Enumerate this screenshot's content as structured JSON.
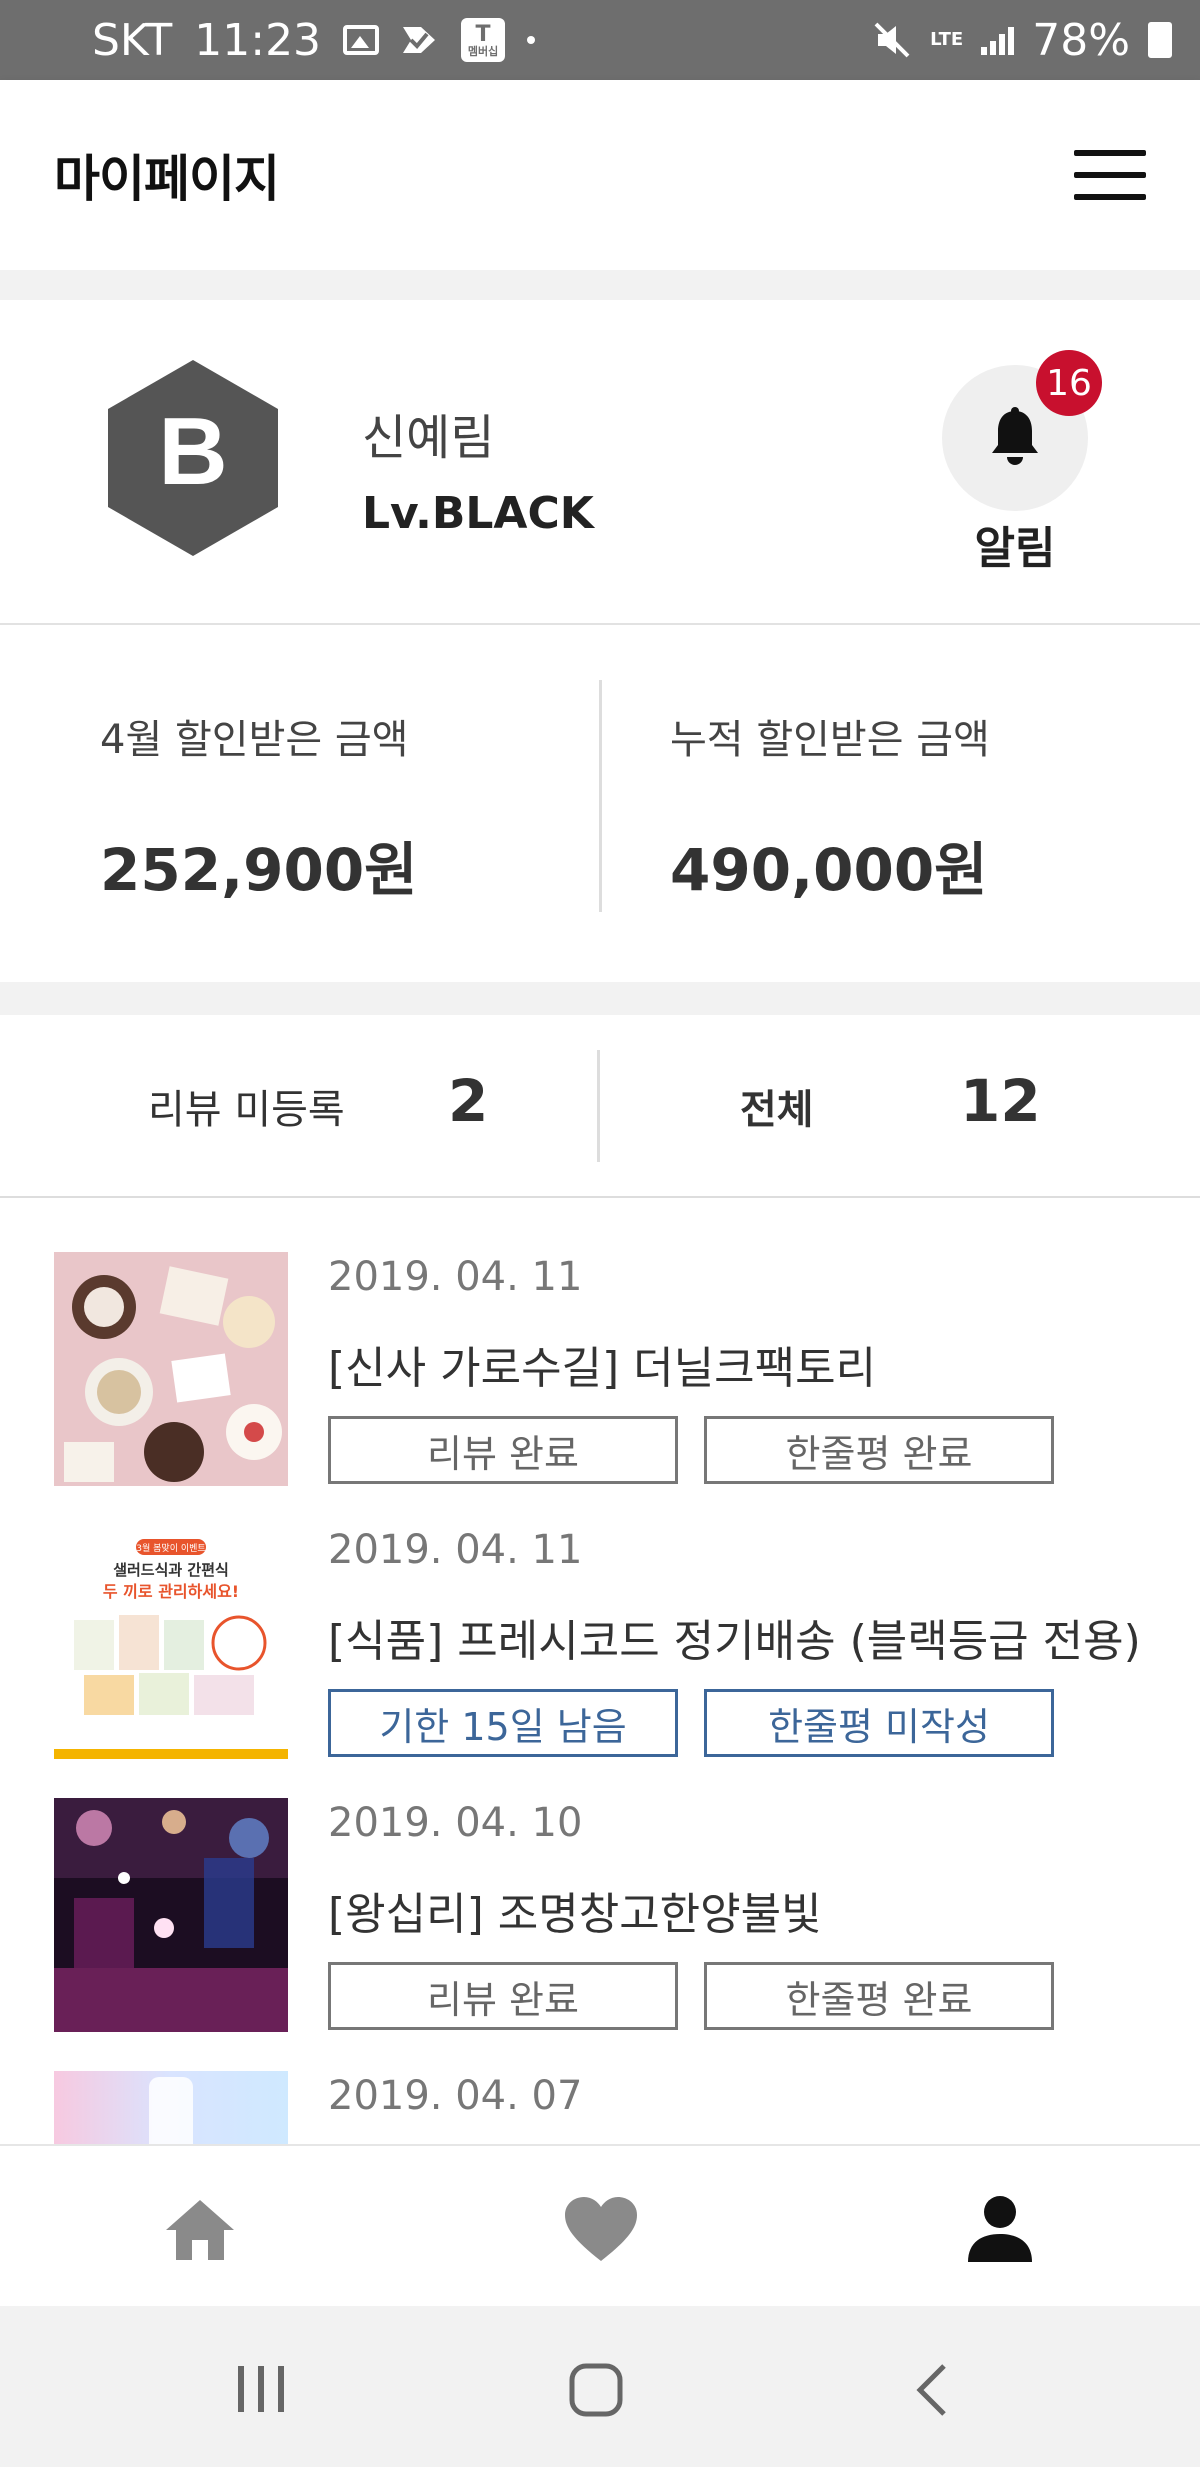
{
  "status_bar": {
    "carrier": "SKT",
    "time": "11:23",
    "tbox_label": "멤버십",
    "network": "LTE",
    "battery": "78%"
  },
  "header": {
    "title": "마이페이지"
  },
  "profile": {
    "badge_letter": "B",
    "name": "신예림",
    "level": "Lv.BLACK",
    "notification_count": "16",
    "notification_label": "알림"
  },
  "savings": {
    "month_label": "4월 할인받은 금액",
    "month_value": "252,900원",
    "total_label": "누적 할인받은 금액",
    "total_value": "490,000원"
  },
  "review_counts": {
    "pending_label": "리뷰 미등록",
    "pending_value": "2",
    "total_label": "전체",
    "total_value": "12"
  },
  "reviews": [
    {
      "date": "2019. 04. 11",
      "title": "[신사 가로수길] 더닐크팩토리",
      "tag1": "리뷰 완료",
      "tag2": "한줄평 완료"
    },
    {
      "date": "2019. 04. 11",
      "title": "[식품] 프레시코드 정기배송 (블랙등급 전용)",
      "tag1": "기한 15일 남음",
      "tag2": "한줄평 미작성",
      "thumb_badge": "3월 봄맞이 이벤트",
      "thumb_text1": "샐러드식과 간편식",
      "thumb_text2": "두 끼로 관리하세요!"
    },
    {
      "date": "2019. 04. 10",
      "title": "[왕십리] 조명창고한양불빛",
      "tag1": "리뷰 완료",
      "tag2": "한줄평 완료"
    },
    {
      "date": "2019. 04. 07",
      "title": "",
      "tag1": "",
      "tag2": ""
    }
  ],
  "colors": {
    "accent_blue": "#3c6699",
    "badge_red": "#c8102e",
    "hex_badge": "#555555"
  },
  "icons": {
    "nav": [
      "home-icon",
      "heart-icon",
      "person-icon"
    ],
    "android": [
      "recent-apps-icon",
      "home-button-icon",
      "back-icon"
    ]
  }
}
